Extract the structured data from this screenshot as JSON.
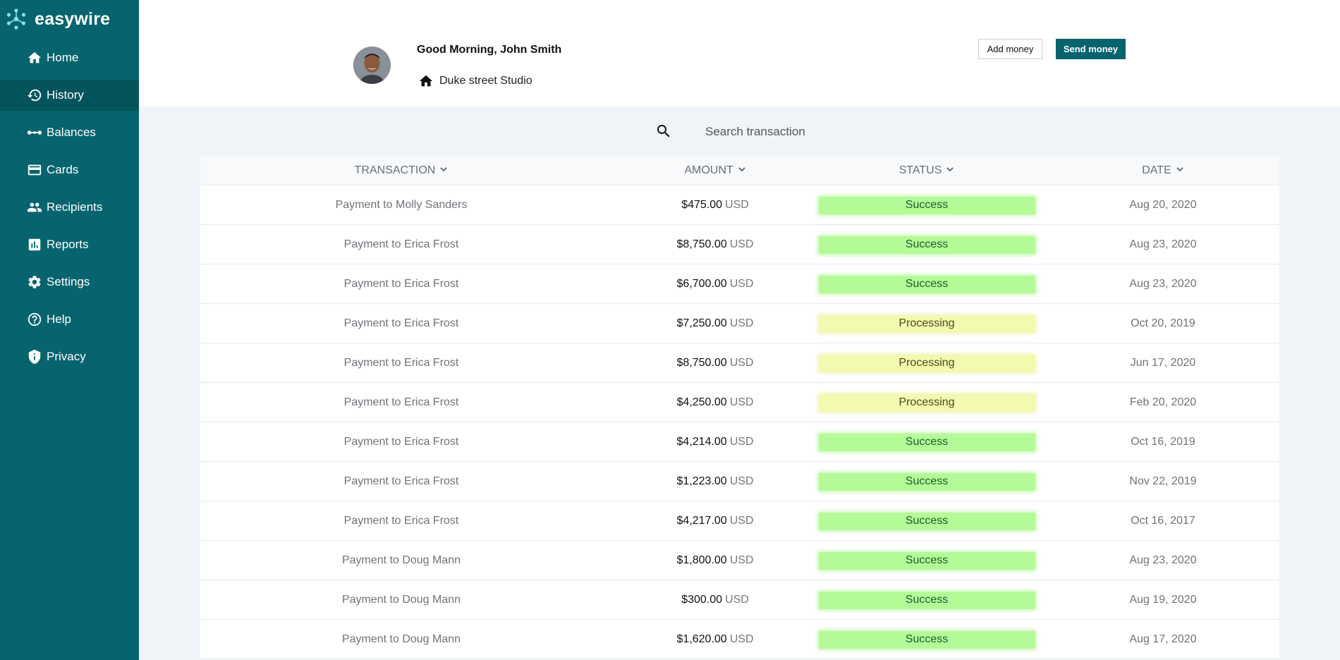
{
  "app": {
    "name": "easywire"
  },
  "sidebar": {
    "items": [
      {
        "label": "Home",
        "icon": "home-icon",
        "active": false
      },
      {
        "label": "History",
        "icon": "history-icon",
        "active": true
      },
      {
        "label": "Balances",
        "icon": "balances-icon",
        "active": false
      },
      {
        "label": "Cards",
        "icon": "card-icon",
        "active": false
      },
      {
        "label": "Recipients",
        "icon": "people-icon",
        "active": false
      },
      {
        "label": "Reports",
        "icon": "chart-icon",
        "active": false
      },
      {
        "label": "Settings",
        "icon": "gear-icon",
        "active": false
      },
      {
        "label": "Help",
        "icon": "help-icon",
        "active": false
      },
      {
        "label": "Privacy",
        "icon": "shield-icon",
        "active": false
      }
    ]
  },
  "header": {
    "greeting": "Good Morning, John Smith",
    "location": "Duke street Studio",
    "add_money_label": "Add money",
    "send_money_label": "Send money"
  },
  "search": {
    "placeholder": "Search transaction"
  },
  "table": {
    "columns": [
      "TRANSACTION",
      "AMOUNT",
      "STATUS",
      "DATE"
    ],
    "rows": [
      {
        "transaction": "Payment to Molly Sanders",
        "amount": "$475.00",
        "currency": "USD",
        "status": "Success",
        "date": "Aug 20, 2020"
      },
      {
        "transaction": "Payment to Erica Frost",
        "amount": "$8,750.00",
        "currency": "USD",
        "status": "Success",
        "date": "Aug 23, 2020"
      },
      {
        "transaction": "Payment to Erica Frost",
        "amount": "$6,700.00",
        "currency": "USD",
        "status": "Success",
        "date": "Aug 23, 2020"
      },
      {
        "transaction": "Payment to Erica Frost",
        "amount": "$7,250.00",
        "currency": "USD",
        "status": "Processing",
        "date": "Oct 20, 2019"
      },
      {
        "transaction": "Payment to Erica Frost",
        "amount": "$8,750.00",
        "currency": "USD",
        "status": "Processing",
        "date": "Jun 17, 2020"
      },
      {
        "transaction": "Payment to Erica Frost",
        "amount": "$4,250.00",
        "currency": "USD",
        "status": "Processing",
        "date": "Feb 20, 2020"
      },
      {
        "transaction": "Payment to Erica Frost",
        "amount": "$4,214.00",
        "currency": "USD",
        "status": "Success",
        "date": "Oct 16, 2019"
      },
      {
        "transaction": "Payment to Erica Frost",
        "amount": "$1,223.00",
        "currency": "USD",
        "status": "Success",
        "date": "Nov 22, 2019"
      },
      {
        "transaction": "Payment to Erica Frost",
        "amount": "$4,217.00",
        "currency": "USD",
        "status": "Success",
        "date": "Oct 16, 2017"
      },
      {
        "transaction": "Payment to Doug Mann",
        "amount": "$1,800.00",
        "currency": "USD",
        "status": "Success",
        "date": "Aug 23, 2020"
      },
      {
        "transaction": "Payment to Doug Mann",
        "amount": "$300.00",
        "currency": "USD",
        "status": "Success",
        "date": "Aug 19, 2020"
      },
      {
        "transaction": "Payment to Doug Mann",
        "amount": "$1,620.00",
        "currency": "USD",
        "status": "Success",
        "date": "Aug 17, 2020"
      }
    ]
  },
  "colors": {
    "sidebar": "#07646e",
    "sidebar_active": "#04545c",
    "success": "#b4fb98",
    "processing": "#f3f9ae",
    "accent": "#07646e"
  }
}
